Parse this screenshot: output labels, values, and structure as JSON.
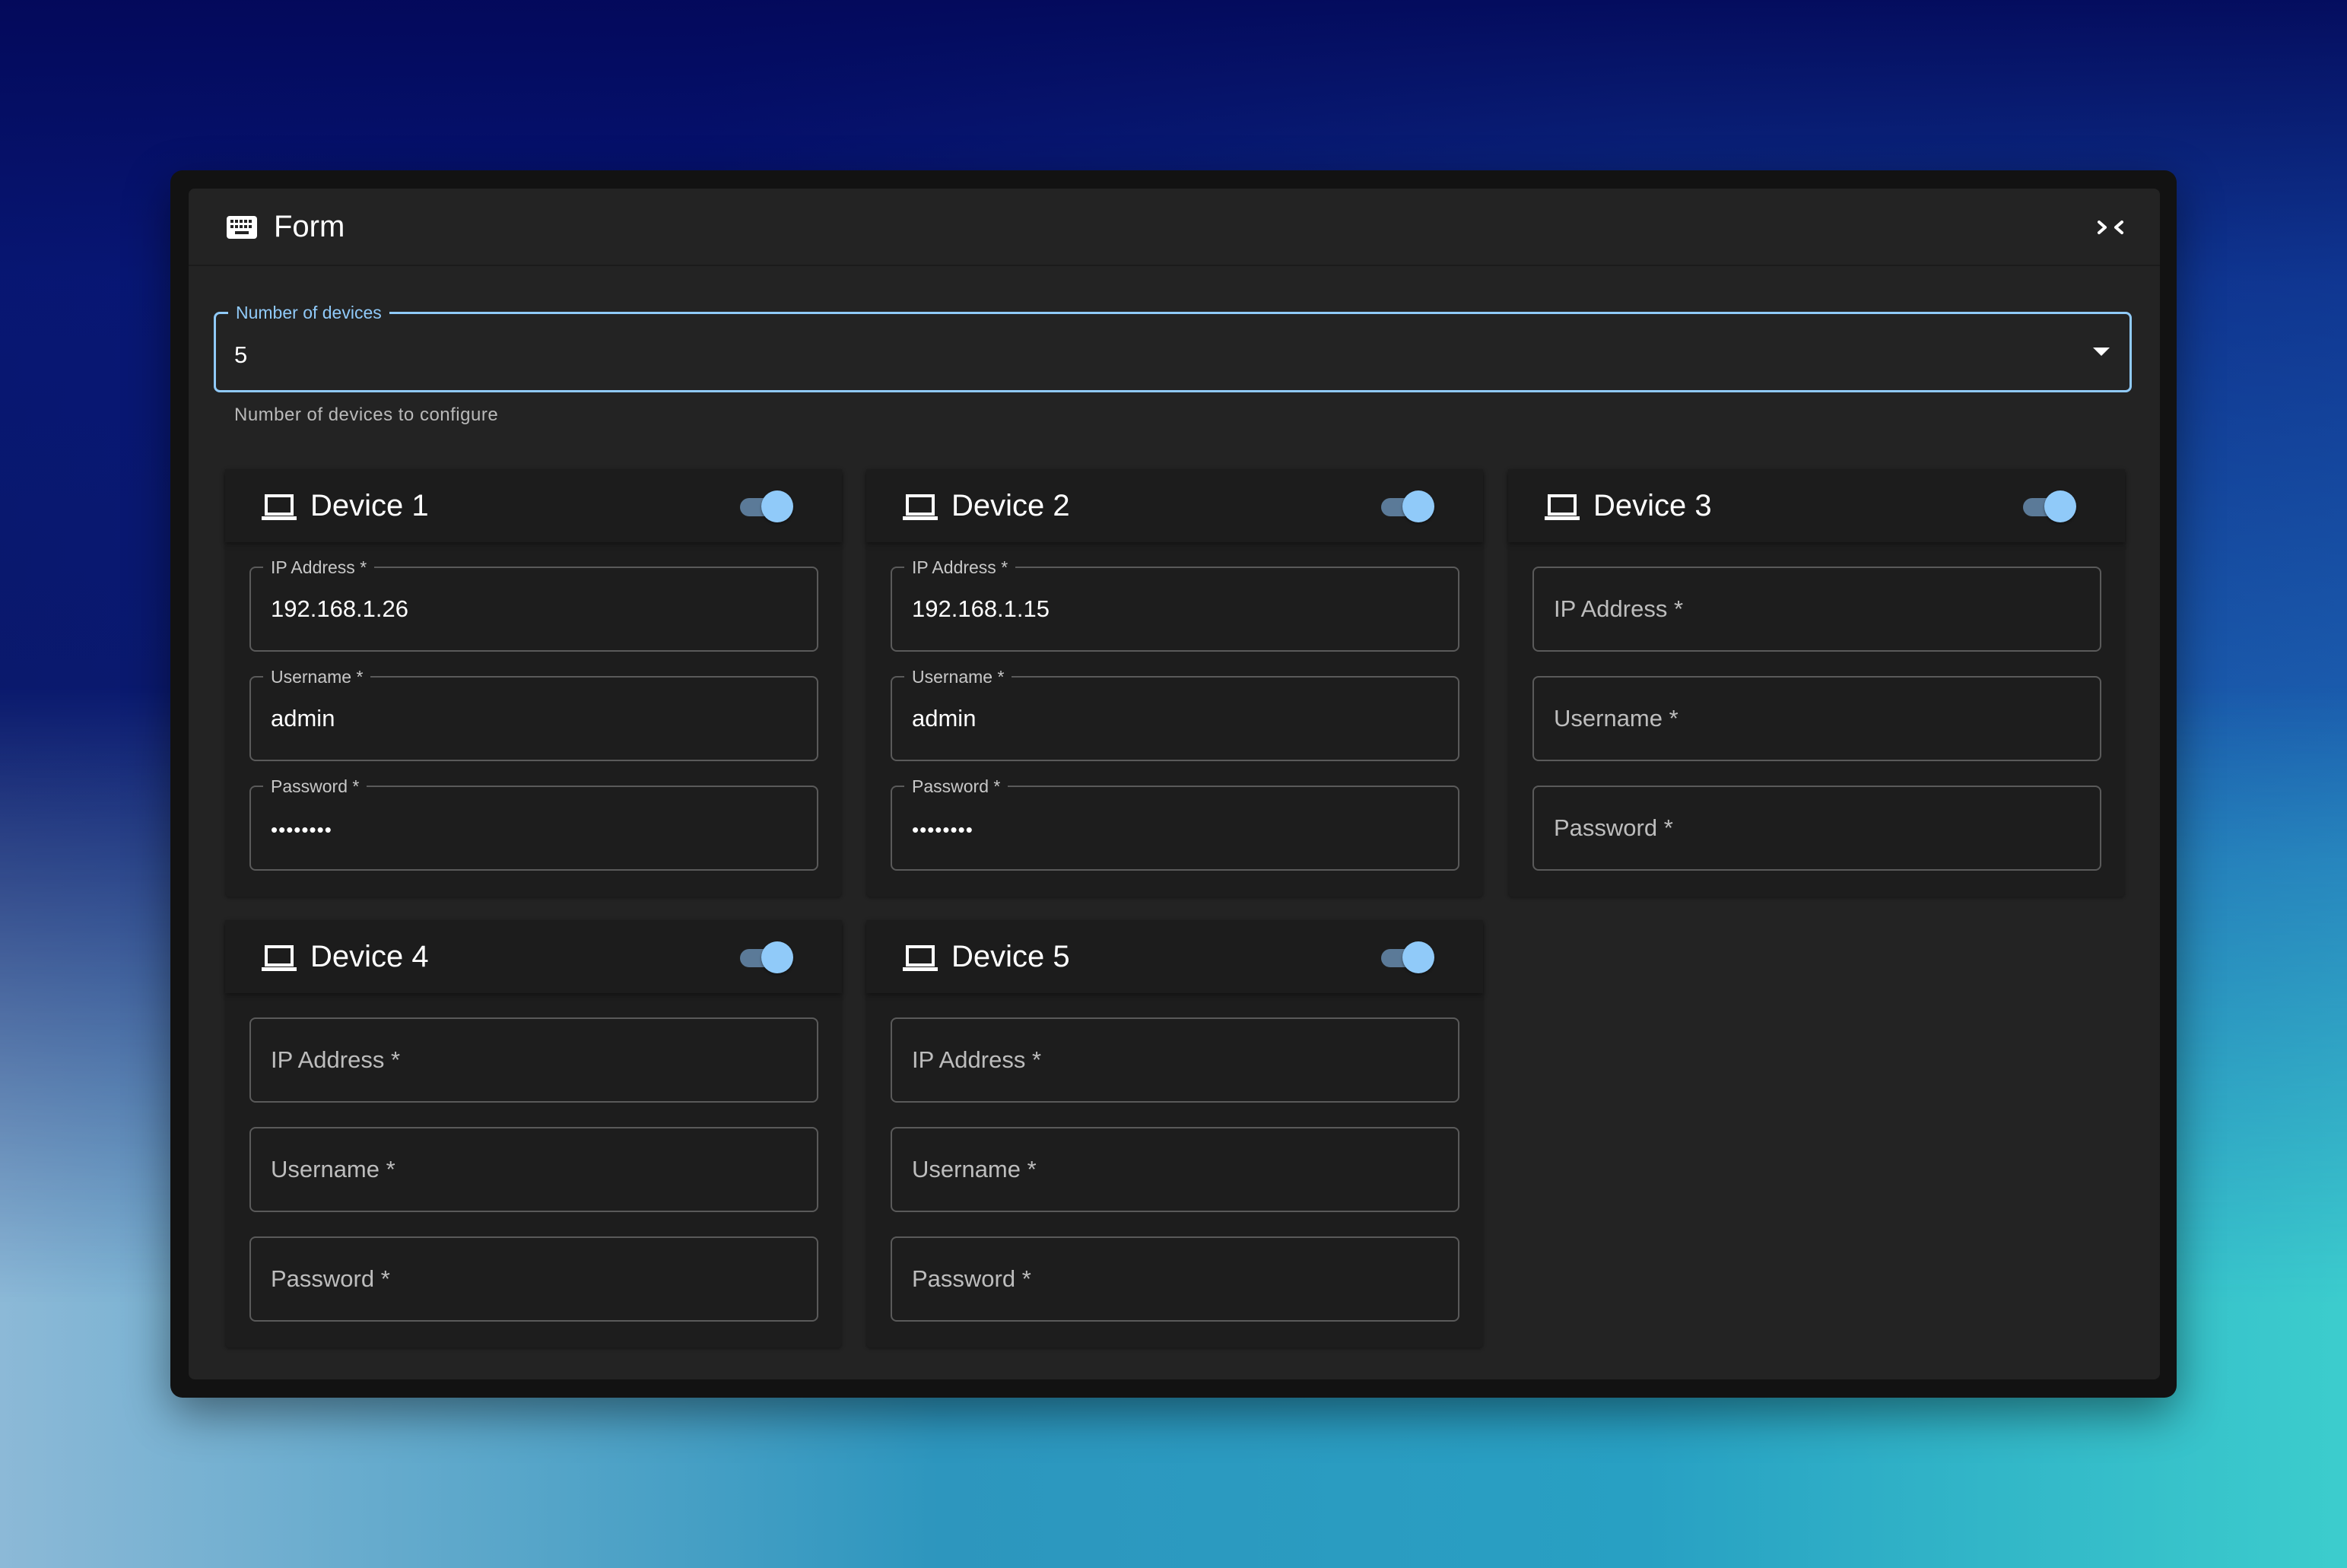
{
  "panel": {
    "title": "Form",
    "title_icon": "keyboard-icon",
    "collapse_icon": "collapse-horizontal-icon"
  },
  "device_count_select": {
    "label": "Number of devices",
    "value": "5",
    "helper_text": "Number of devices to configure",
    "accent_color": "#90caf9"
  },
  "devices": [
    {
      "title": "Device 1",
      "enabled": true,
      "fields": [
        {
          "label": "IP Address *",
          "value": "192.168.1.26"
        },
        {
          "label": "Username *",
          "value": "admin"
        },
        {
          "label": "Password *",
          "value": "••••••••"
        }
      ]
    },
    {
      "title": "Device 2",
      "enabled": true,
      "fields": [
        {
          "label": "IP Address *",
          "value": "192.168.1.15"
        },
        {
          "label": "Username *",
          "value": "admin"
        },
        {
          "label": "Password *",
          "value": "••••••••"
        }
      ]
    },
    {
      "title": "Device 3",
      "enabled": true,
      "fields": [
        {
          "label": "IP Address *",
          "value": ""
        },
        {
          "label": "Username *",
          "value": ""
        },
        {
          "label": "Password *",
          "value": ""
        }
      ]
    },
    {
      "title": "Device 4",
      "enabled": true,
      "fields": [
        {
          "label": "IP Address *",
          "value": ""
        },
        {
          "label": "Username *",
          "value": ""
        },
        {
          "label": "Password *",
          "value": ""
        }
      ]
    },
    {
      "title": "Device 5",
      "enabled": true,
      "fields": [
        {
          "label": "IP Address *",
          "value": ""
        },
        {
          "label": "Username *",
          "value": ""
        },
        {
          "label": "Password *",
          "value": ""
        }
      ]
    }
  ],
  "colors": {
    "panel_bg": "#232323",
    "card_bg": "#1d1d1d",
    "toggle_thumb": "#90caf9",
    "toggle_track": "#5b7a98"
  }
}
